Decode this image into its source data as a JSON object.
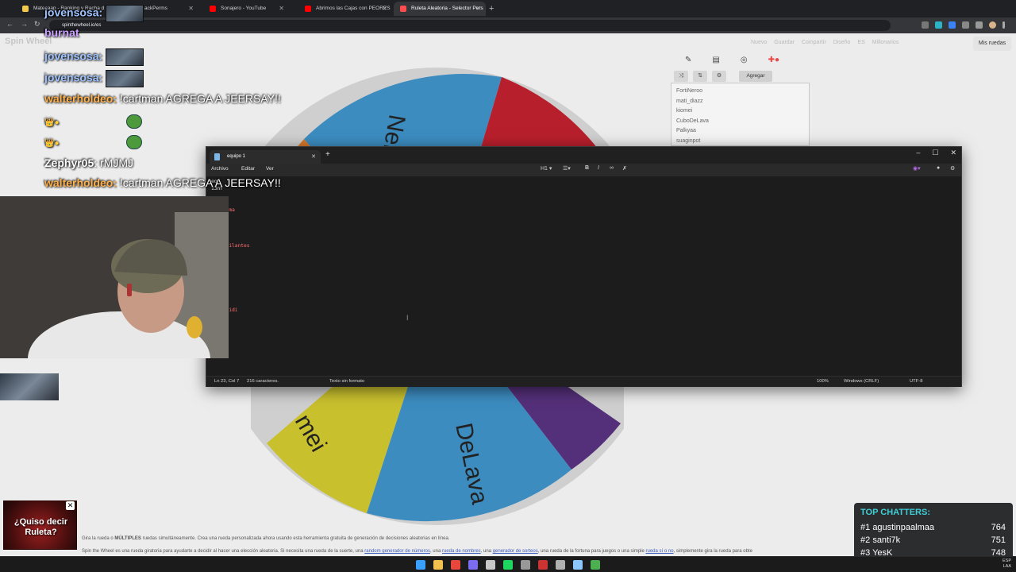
{
  "browser": {
    "tabs": [
      {
        "title": "Matecaap - Ranking y Racha d",
        "color": "#f2c94c"
      },
      {
        "title": "...",
        "color": "#888888"
      },
      {
        "title": "ackPerms",
        "color": "#888888"
      },
      {
        "title": "Sonajero - YouTube",
        "color": "#ff0000"
      },
      {
        "title": "Abrimos las Cajas con PEORES",
        "color": "#ff0000"
      },
      {
        "title": "Ruleta Aleatoria - Selector Pers",
        "color": "#ff0000"
      }
    ],
    "address": "spinthewheel.io/es"
  },
  "site": {
    "logo": "Spin Wheel",
    "nav": [
      "Nuevo",
      "Guardar",
      "Compartir",
      "Diseño",
      "ES",
      "Millonarios"
    ],
    "my_wheels": "Mis ruedas",
    "add_label": "Agregar",
    "entries": [
      "FortiNeroo",
      "mati_diazz",
      "kiomei",
      "CuboDeLava",
      "Palkyaa",
      "suaginpot"
    ],
    "wheel_labels": [
      "Neroo",
      "mei",
      "DeLava"
    ],
    "desc_line1_pre": "Gira la rueda o ",
    "desc_line1_bold": "MÚLTIPLES",
    "desc_line1_post": " ruedas simultáneamente. Crea una rueda personalizada ahora usando esta herramienta gratuita de generación de decisiones aleatorias en línea.",
    "desc_line2_a": "Spin the Wheel es una rueda giratoria para ayudarte a decidir al hacer una elección aleatoria. Si necesita una rueda de la suerte, una ",
    "desc_link1": "random generador de números",
    "desc_line2_b": ", una ",
    "desc_link2": "rueda de nombres",
    "desc_line2_c": ", una ",
    "desc_link3": "generador de sorteos",
    "desc_line2_d": ", una rueda de la fortuna para juegos o una simple ",
    "desc_link4": "rueda sí o no",
    "desc_line2_e": ", simplemente gira la rueda para obte"
  },
  "notepad": {
    "tab_title": "equipo 1",
    "menu": [
      "Archivo",
      "Editar",
      "Ver"
    ],
    "heading_btn": "H1",
    "lines": [
      {
        "text": "eq",
        "color": "#e8e8e8"
      },
      {
        "text": "13nf",
        "color": "#e8e8e8"
      },
      {
        "text": "",
        "color": "#e8e8e8"
      },
      {
        "text": "o",
        "color": "#e8e8e8"
      },
      {
        "text": "inpaalma",
        "color": "#ff6e6e"
      },
      {
        "text": "o 2",
        "color": "#e8e8e8"
      },
      {
        "text": "stou",
        "color": "#ff6e6e"
      },
      {
        "text": "xia",
        "color": "#ff6e6e"
      },
      {
        "text": "sq",
        "color": "#ff6e6e"
      },
      {
        "text": "adevigilantes",
        "color": "#ff6e6e"
      },
      {
        "text": "o 3",
        "color": "#e8e8e8"
      },
      {
        "text": "7k",
        "color": "#e8e8e8"
      },
      {
        "text": "o",
        "color": "#e8e8e8"
      },
      {
        "text": "al",
        "color": "#ff6e6e"
      },
      {
        "text": "",
        "color": "#e8e8e8"
      },
      {
        "text": "o 4",
        "color": "#e8e8e8"
      },
      {
        "text": "",
        "color": "#e8e8e8"
      },
      {
        "text": "-",
        "color": "#e8e8e8"
      },
      {
        "text": "riskibidi",
        "color": "#ff6e6e"
      },
      {
        "text": "",
        "color": "#e8e8e8"
      },
      {
        "text": "o 5",
        "color": "#e8e8e8"
      },
      {
        "text": "stou",
        "color": "#ff6e6e"
      },
      {
        "text": "a",
        "color": "#ff6e6e"
      },
      {
        "text": "oko",
        "color": "#ff6e6e"
      },
      {
        "text": "simon",
        "color": "#ff6e6e"
      }
    ],
    "status": {
      "position": "Ln 23, Col 7",
      "chars": "216 caracteres.",
      "format": "Texto sin formato",
      "zoom": "100%",
      "eol": "Windows (CRLF)",
      "encoding": "UTF-8"
    }
  },
  "chat": [
    {
      "user": "jovensosa:",
      "color": "#9ec3ff",
      "msg": "",
      "emote": true
    },
    {
      "user": "burnat",
      "color": "#c9a0ff",
      "msg": "",
      "emote": false
    },
    {
      "user": "jovensosa:",
      "color": "#9ec3ff",
      "msg": "",
      "emote": true
    },
    {
      "user": "jovensosa:",
      "color": "#9ec3ff",
      "msg": "",
      "emote": true
    },
    {
      "user": "walterholdeo:",
      "color": "#ffb04a",
      "msg": " !cartman AGREGA A JEERSAY!!",
      "emote": false
    },
    {
      "user": "",
      "color": "#ffb04a",
      "msg": "",
      "emote": false,
      "pepe": true
    },
    {
      "user": "",
      "color": "#ffb04a",
      "msg": "",
      "emote": false,
      "pepe": true
    },
    {
      "user": "Zephyr05",
      "color": "#ffffff",
      "msg": ": rMJMJ",
      "emote": false
    },
    {
      "user": "walterholdeo:",
      "color": "#ffb04a",
      "msg": " !cartman AGREGA A JEERSAY!!",
      "emote": false
    }
  ],
  "promo": {
    "text": "¿Quiso decir Ruleta?"
  },
  "top_chatters": {
    "title": "TOP CHATTERS:",
    "rows": [
      {
        "rank": "#1",
        "name": "agustinpaalmaa",
        "count": "764"
      },
      {
        "rank": "#2",
        "name": "santi7k",
        "count": "751"
      },
      {
        "rank": "#3",
        "name": "YesK",
        "count": "748"
      }
    ]
  },
  "taskbar": {
    "icons": [
      "windows-icon",
      "explorer-icon",
      "chrome-icon",
      "discord-icon",
      "steam-icon",
      "spotify-icon",
      "app-icon",
      "app-icon",
      "obs-icon",
      "notepad-icon",
      "app-icon"
    ]
  }
}
